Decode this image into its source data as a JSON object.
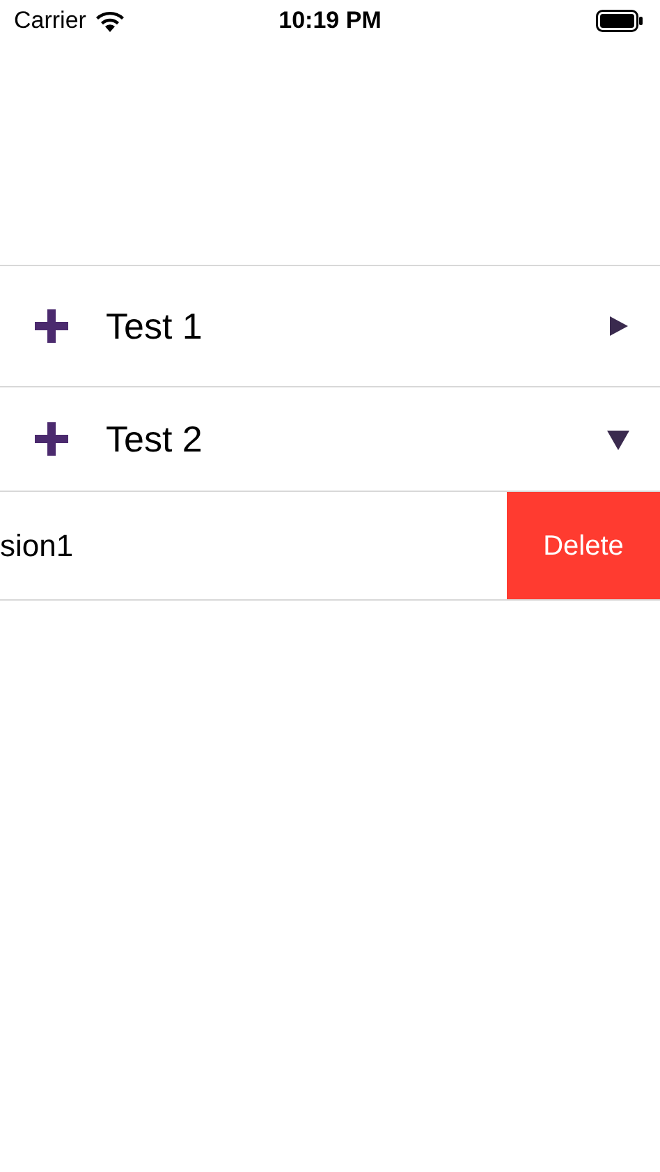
{
  "status_bar": {
    "carrier": "Carrier",
    "time": "10:19 PM"
  },
  "groups": [
    {
      "title": "Test 1",
      "expanded": false
    },
    {
      "title": "Test 2",
      "expanded": true
    }
  ],
  "swiped_row": {
    "text": "sion1",
    "action": "Delete"
  }
}
